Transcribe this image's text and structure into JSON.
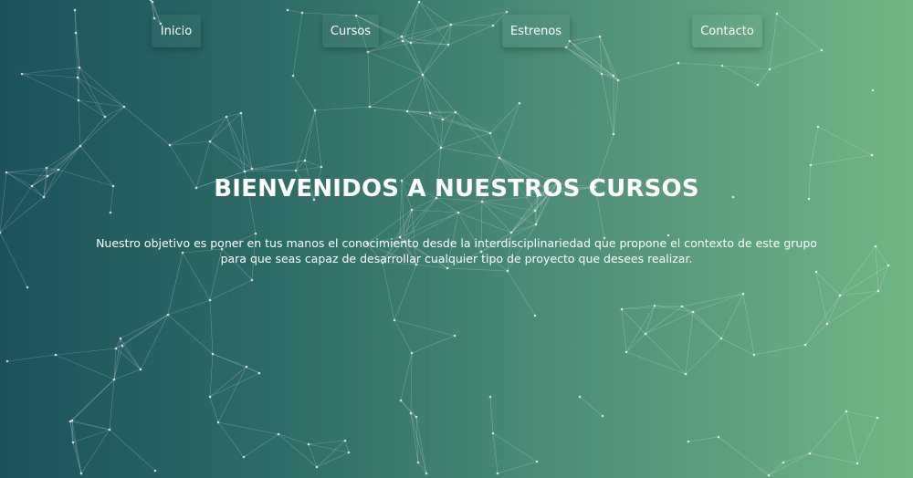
{
  "nav": {
    "items": [
      "Inicio",
      "Cursos",
      "Estrenos",
      "Contacto"
    ]
  },
  "hero": {
    "title": "BIENVENIDOS A NUESTROS CURSOS",
    "description": "Nuestro objetivo es poner en tus manos el conocimiento desde la interdisciplinariedad que propone el contexto de este grupo para que seas capaz de desarrollar cualquier tipo de proyecto que desees realizar."
  },
  "colors": {
    "gradient_start": "#1d525a",
    "gradient_end": "#72b585",
    "text": "#ffffff"
  }
}
